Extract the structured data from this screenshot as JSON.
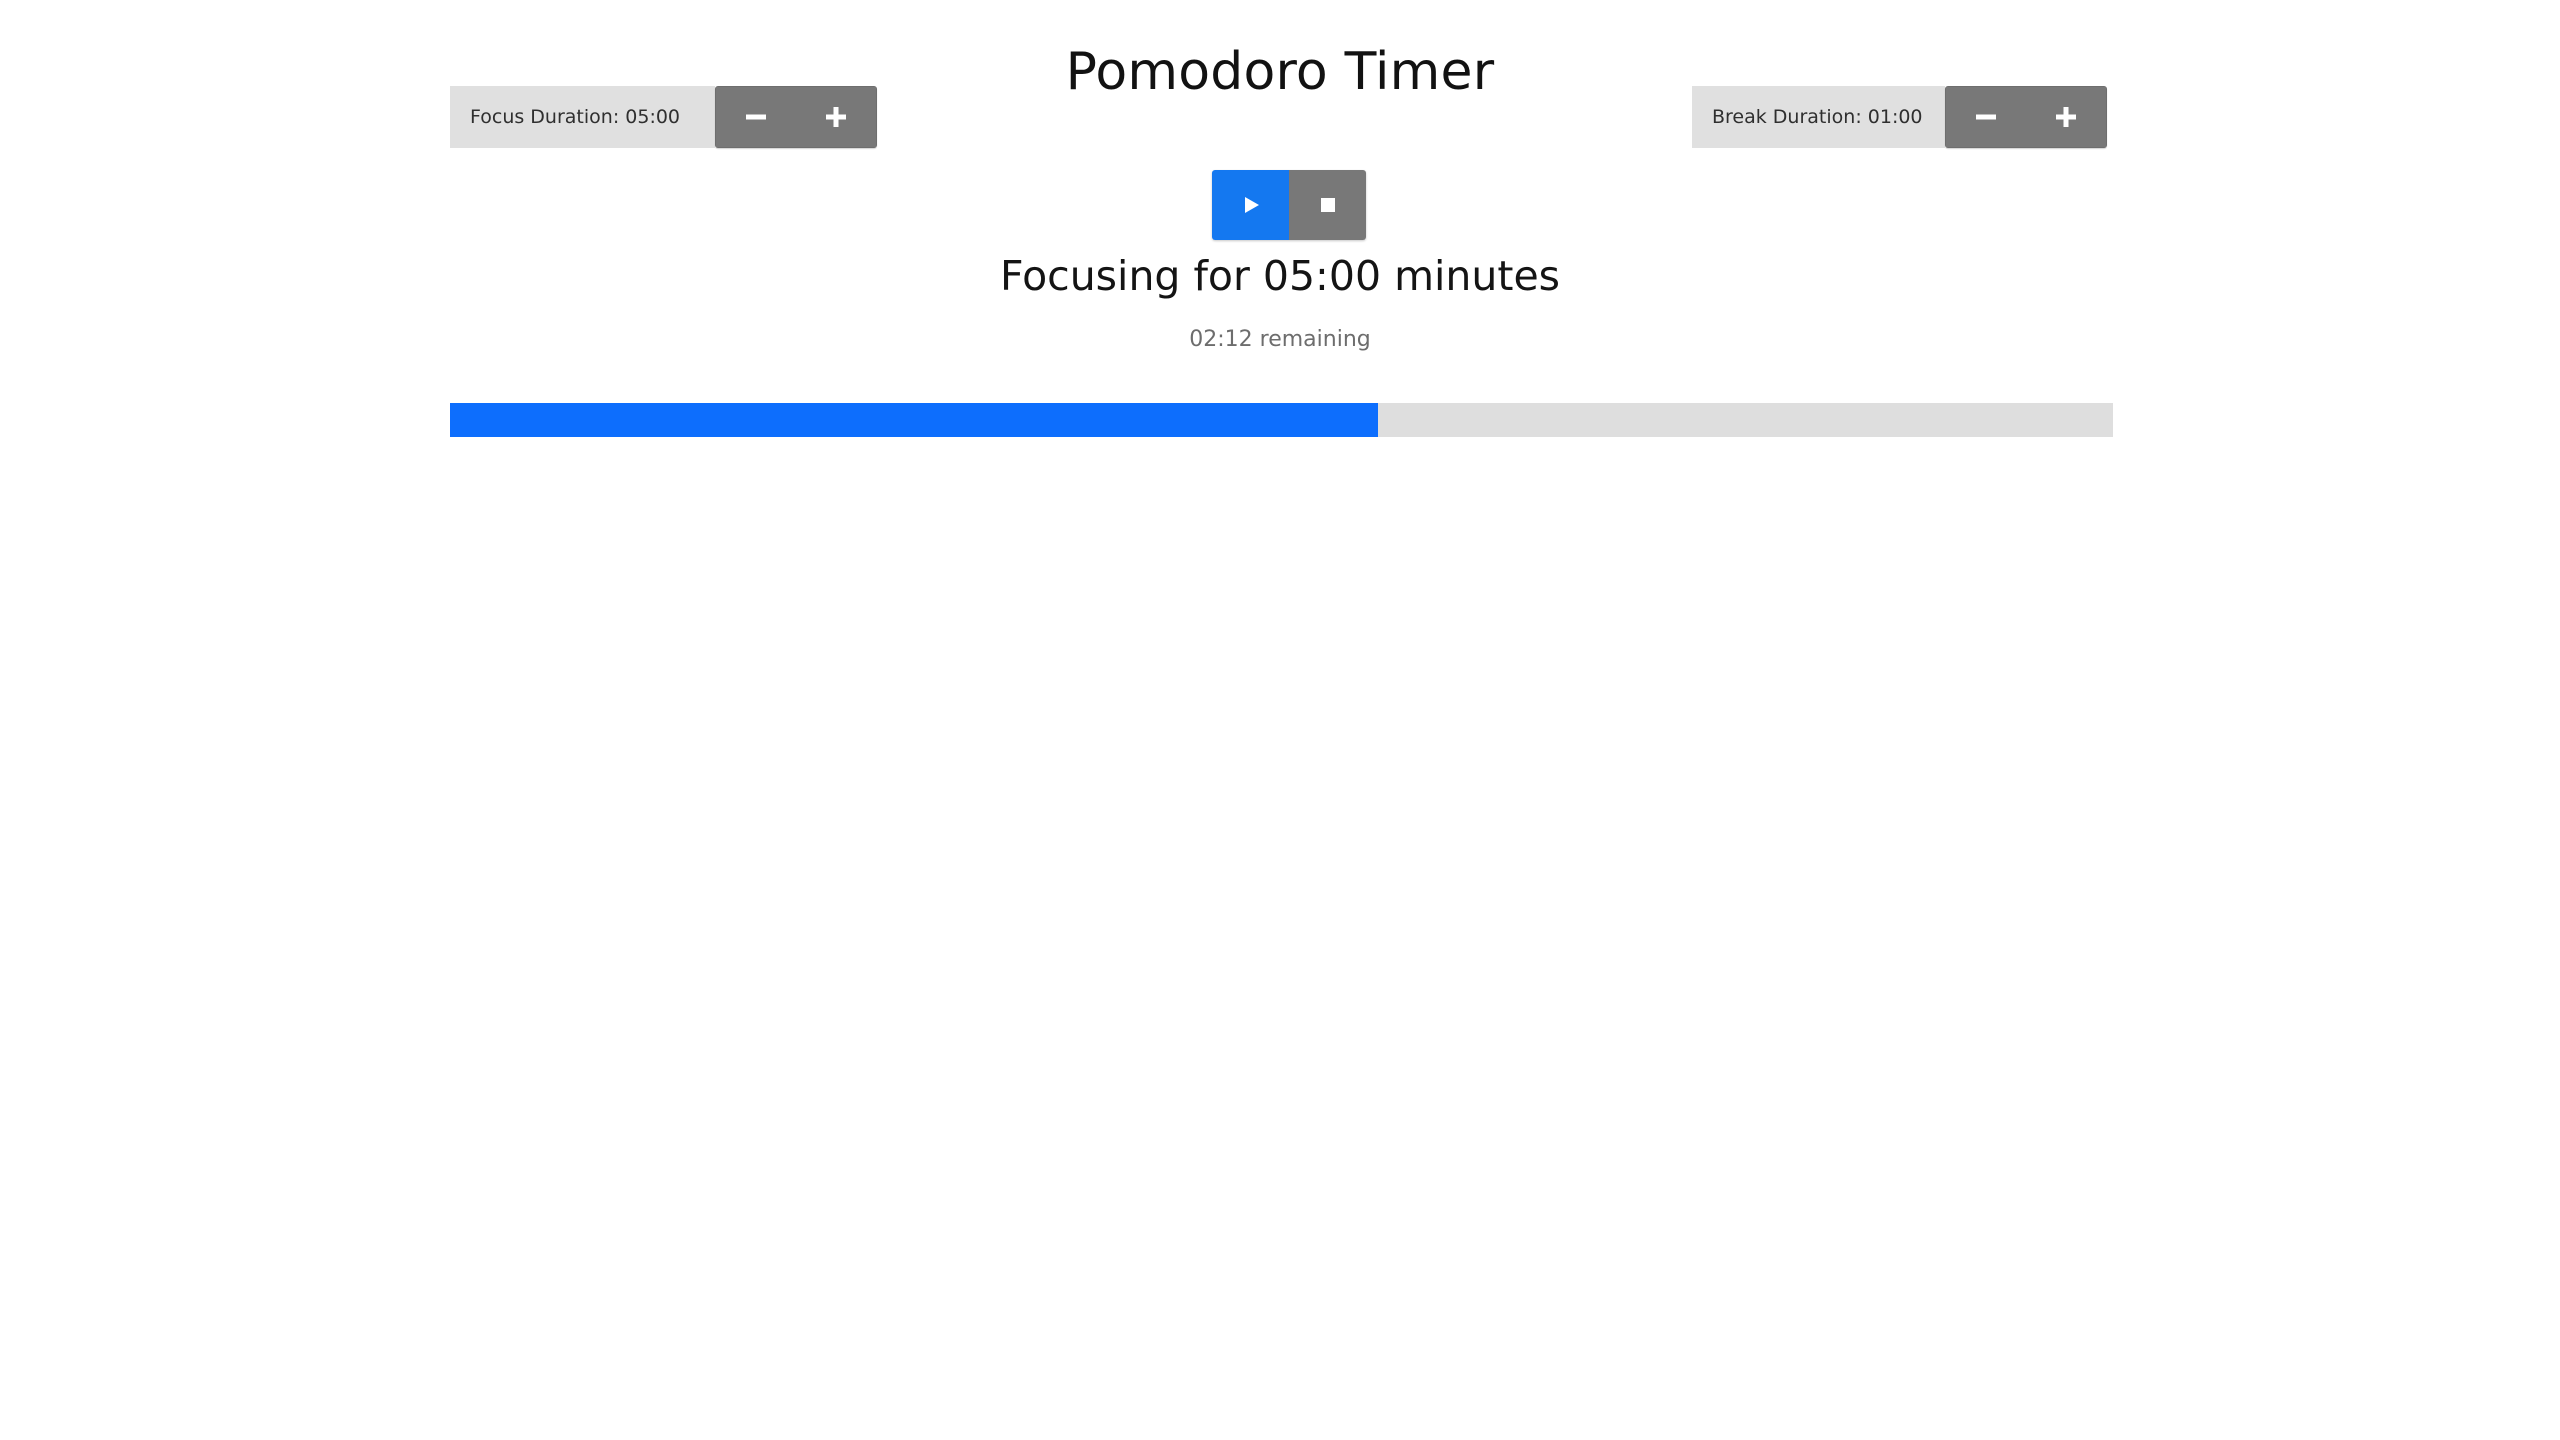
{
  "app": {
    "title": "Pomodoro Timer"
  },
  "focus_control": {
    "label": "Focus Duration: 05:00",
    "value": "05:00",
    "decrease_icon": "minus-icon",
    "increase_icon": "plus-icon"
  },
  "break_control": {
    "label": "Break Duration: 01:00",
    "value": "01:00",
    "decrease_icon": "minus-icon",
    "increase_icon": "plus-icon"
  },
  "transport": {
    "play_icon": "play-icon",
    "stop_icon": "stop-icon",
    "play_active": true
  },
  "status": {
    "heading": "Focusing for 05:00 minutes",
    "remaining": "02:12 remaining"
  },
  "progress": {
    "percent": 55.8,
    "fill_color": "#0d6efd",
    "track_color": "#dedede"
  },
  "colors": {
    "accent": "#1478f0",
    "button_gray": "#787878",
    "label_gray": "#e0e0e0",
    "text_dark": "#141414",
    "text_muted": "#6d6d6d"
  }
}
